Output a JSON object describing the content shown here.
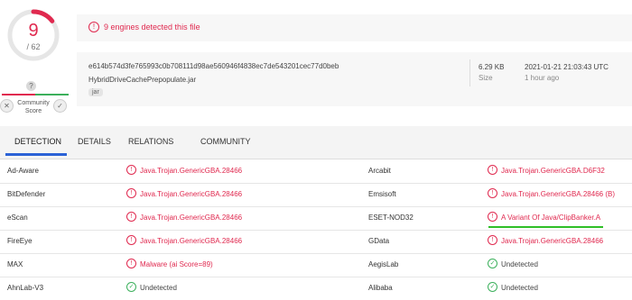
{
  "score": {
    "detected": "9",
    "total": "/ 62"
  },
  "community": {
    "question": "?",
    "label_line1": "Community",
    "label_line2": "Score",
    "down": "✕",
    "up": "✓"
  },
  "alert": {
    "icon": "!",
    "text": "9 engines detected this file"
  },
  "file": {
    "hash": "e614b574d3fe765993c0b708111d98ae560946f4838ec7de543201cec77d0beb",
    "name": "HybridDriveCachePrepopulate.jar",
    "tag": "jar",
    "size": "6.29 KB",
    "size_label": "Size",
    "date": "2021-01-21 21:03:43 UTC",
    "ago": "1 hour ago"
  },
  "tabs": [
    "DETECTION",
    "DETAILS",
    "RELATIONS",
    "COMMUNITY"
  ],
  "detections": [
    {
      "left": {
        "engine": "Ad-Aware",
        "result": "Java.Trojan.GenericGBA.28466",
        "detected": true
      },
      "right": {
        "engine": "Arcabit",
        "result": "Java.Trojan.GenericGBA.D6F32",
        "detected": true
      }
    },
    {
      "left": {
        "engine": "BitDefender",
        "result": "Java.Trojan.GenericGBA.28466",
        "detected": true
      },
      "right": {
        "engine": "Emsisoft",
        "result": "Java.Trojan.GenericGBA.28466 (B)",
        "detected": true
      }
    },
    {
      "left": {
        "engine": "eScan",
        "result": "Java.Trojan.GenericGBA.28466",
        "detected": true
      },
      "right": {
        "engine": "ESET-NOD32",
        "result": "A Variant Of Java/ClipBanker.A",
        "detected": true
      }
    },
    {
      "left": {
        "engine": "FireEye",
        "result": "Java.Trojan.GenericGBA.28466",
        "detected": true
      },
      "right": {
        "engine": "GData",
        "result": "Java.Trojan.GenericGBA.28466",
        "detected": true
      }
    },
    {
      "left": {
        "engine": "MAX",
        "result": "Malware (ai Score=89)",
        "detected": true
      },
      "right": {
        "engine": "AegisLab",
        "result": "Undetected",
        "detected": false
      }
    },
    {
      "left": {
        "engine": "AhnLab-V3",
        "result": "Undetected",
        "detected": false
      },
      "right": {
        "engine": "Alibaba",
        "result": "Undetected",
        "detected": false
      }
    }
  ],
  "colors": {
    "detected": "#e0294f",
    "undetected": "#3cb05c",
    "accent": "#2b62d6",
    "highlight": "#2fbf27"
  }
}
